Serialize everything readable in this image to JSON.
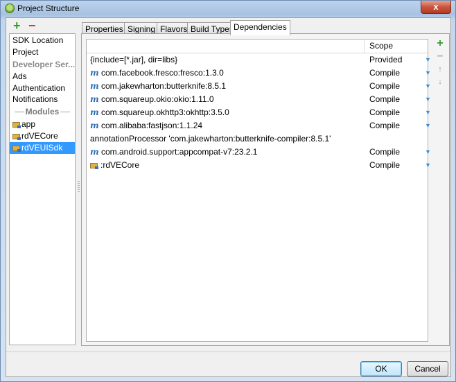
{
  "window": {
    "title": "Project Structure",
    "close_glyph": "x",
    "icon": "android-studio-icon"
  },
  "left_panel": {
    "add_glyph": "+",
    "remove_glyph": "−",
    "items": [
      {
        "label": "SDK Location"
      },
      {
        "label": "Project"
      },
      {
        "label": "Developer Ser..."
      },
      {
        "label": "Ads"
      },
      {
        "label": "Authentication"
      },
      {
        "label": "Notifications"
      },
      {
        "label": "Modules"
      },
      {
        "label": "app"
      },
      {
        "label": "rdVECore"
      },
      {
        "label": "rdVEUISdk"
      }
    ]
  },
  "tabs": [
    {
      "label": "Properties"
    },
    {
      "label": "Signing"
    },
    {
      "label": "Flavors"
    },
    {
      "label": "Build Types"
    },
    {
      "label": "Dependencies"
    }
  ],
  "dependencies": {
    "header": {
      "scope": "Scope"
    },
    "rows": [
      {
        "name": "{include=[*.jar], dir=libs}",
        "scope": "Provided",
        "icon": "none"
      },
      {
        "name": "com.facebook.fresco:fresco:1.3.0",
        "scope": "Compile",
        "icon": "maven-icon"
      },
      {
        "name": "com.jakewharton:butterknife:8.5.1",
        "scope": "Compile",
        "icon": "maven-icon"
      },
      {
        "name": "com.squareup.okio:okio:1.11.0",
        "scope": "Compile",
        "icon": "maven-icon"
      },
      {
        "name": "com.squareup.okhttp3:okhttp:3.5.0",
        "scope": "Compile",
        "icon": "maven-icon"
      },
      {
        "name": "com.alibaba:fastjson:1.1.24",
        "scope": "Compile",
        "icon": "maven-icon"
      },
      {
        "name": "annotationProcessor 'com.jakewharton:butterknife-compiler:8.5.1'",
        "scope": "",
        "icon": "none"
      },
      {
        "name": "com.android.support:appcompat-v7:23.2.1",
        "scope": "Compile",
        "icon": "maven-icon"
      },
      {
        "name": ":rdVECore",
        "scope": "Compile",
        "icon": "module-icon"
      }
    ],
    "maven_glyph": "m",
    "arrow_glyph": "▼"
  },
  "side_tools": {
    "add_glyph": "+",
    "remove_glyph": "−",
    "up_glyph": "↑",
    "down_glyph": "↓"
  },
  "buttons": {
    "ok": "OK",
    "cancel": "Cancel"
  },
  "colors": {
    "selection": "#3399ff",
    "add": "#3b9a2f",
    "remove": "#d23b2f",
    "maven": "#2e6db3"
  }
}
